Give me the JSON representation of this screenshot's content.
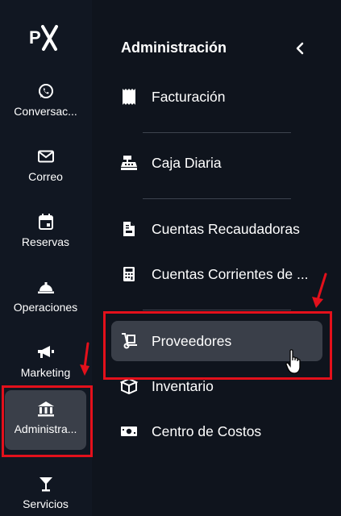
{
  "logo_text": "PX",
  "rail": {
    "items": [
      {
        "label": "Conversac...",
        "icon": "whatsapp-icon"
      },
      {
        "label": "Correo",
        "icon": "mail-icon"
      },
      {
        "label": "Reservas",
        "icon": "calendar-icon"
      },
      {
        "label": "Operaciones",
        "icon": "service-bell-icon"
      },
      {
        "label": "Marketing",
        "icon": "megaphone-icon"
      },
      {
        "label": "Administra...",
        "icon": "bank-icon",
        "active": true
      },
      {
        "label": "Servicios",
        "icon": "cocktail-icon"
      }
    ]
  },
  "panel": {
    "title": "Administración",
    "items": [
      {
        "label": "Facturación",
        "icon": "receipt-icon"
      },
      {
        "label": "Caja Diaria",
        "icon": "cash-register-icon"
      },
      {
        "label": "Cuentas Recaudadoras",
        "icon": "invoice-icon"
      },
      {
        "label": "Cuentas Corrientes de ...",
        "icon": "calculator-icon"
      },
      {
        "label": "Proveedores",
        "icon": "dolly-icon",
        "hovered": true
      },
      {
        "label": "Inventario",
        "icon": "box-icon"
      },
      {
        "label": "Centro de Costos",
        "icon": "money-bill-icon"
      }
    ]
  },
  "colors": {
    "background": "#111722",
    "panel": "#0f141d",
    "active": "#3a3f49",
    "annotation": "#e3101b"
  }
}
